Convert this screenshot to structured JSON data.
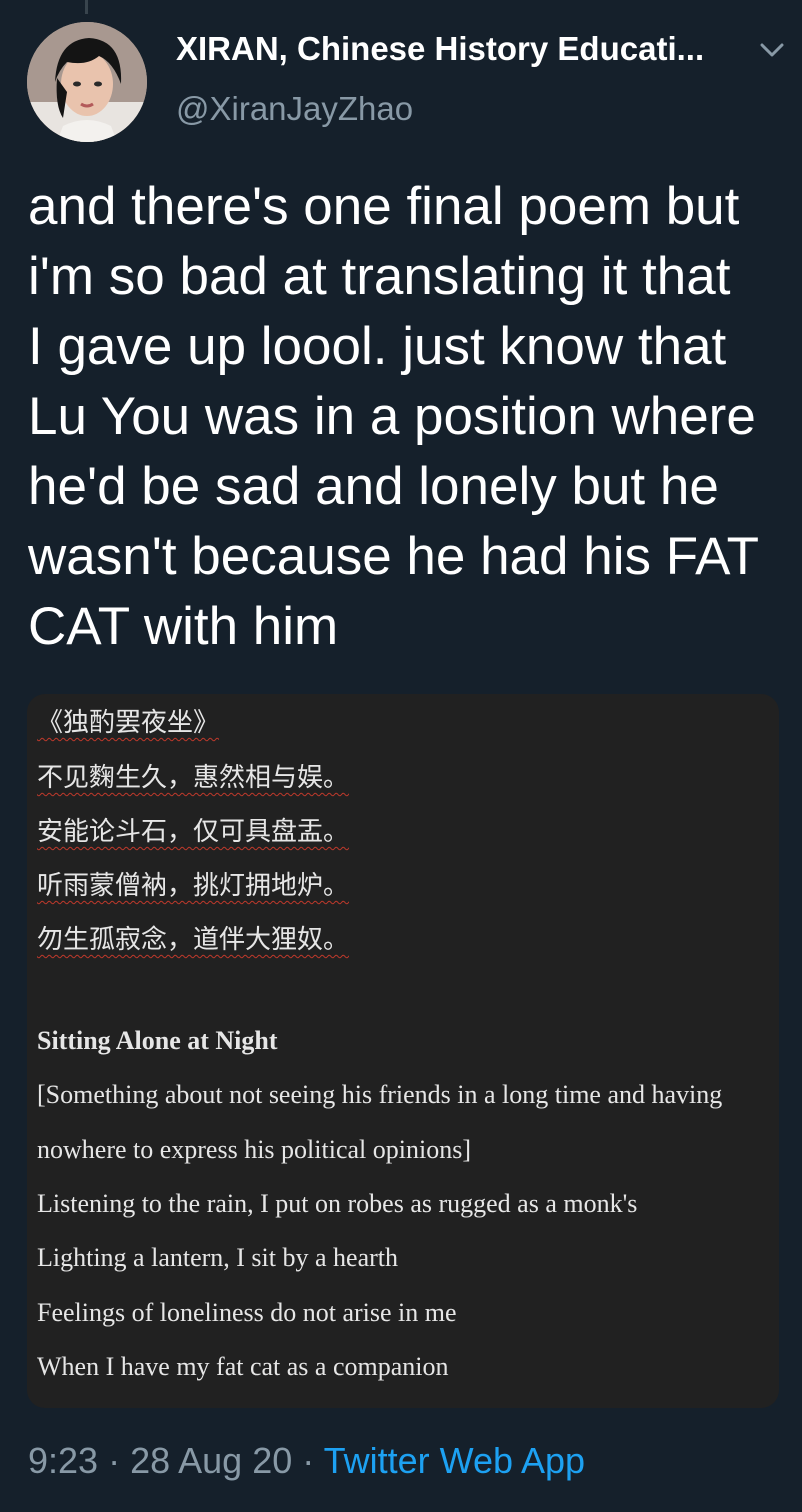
{
  "author": {
    "display_name": "XIRAN, Chinese History Educati...",
    "handle": "@XiranJayZhao"
  },
  "tweet": {
    "text": "and there's one final poem but\ni'm so bad at translating it that\nI gave up loool. just know that\nLu You was in a position where\nhe'd be sad and lonely but he\nwasn't because he had his FAT\nCAT with him"
  },
  "media": {
    "chinese_title": "《独酌罢夜坐》",
    "chinese_lines": [
      "不见麴生久，惠然相与娱。",
      "安能论斗石，仅可具盘盂。",
      "听雨蒙僧衲，挑灯拥地炉。",
      "勿生孤寂念，道伴大狸奴。"
    ],
    "english_title": "Sitting Alone at Night",
    "english_lines": [
      "[Something about not seeing his friends in a long time and having",
      "nowhere to express his political opinions]",
      "Listening to the rain, I put on robes as rugged as a monk's",
      "Lighting a lantern, I sit by a hearth",
      "Feelings of loneliness do not arise in me",
      "When I have my fat cat as a companion"
    ]
  },
  "meta": {
    "time": "9:23",
    "separator": " · ",
    "date": "28 Aug 20",
    "source": "Twitter Web App"
  },
  "icons": {
    "caret": "chevron-down-icon"
  },
  "colors": {
    "background": "#15202b",
    "text": "#ffffff",
    "secondary": "#8899a6",
    "link": "#1da1f2",
    "media_bg": "#212121"
  }
}
